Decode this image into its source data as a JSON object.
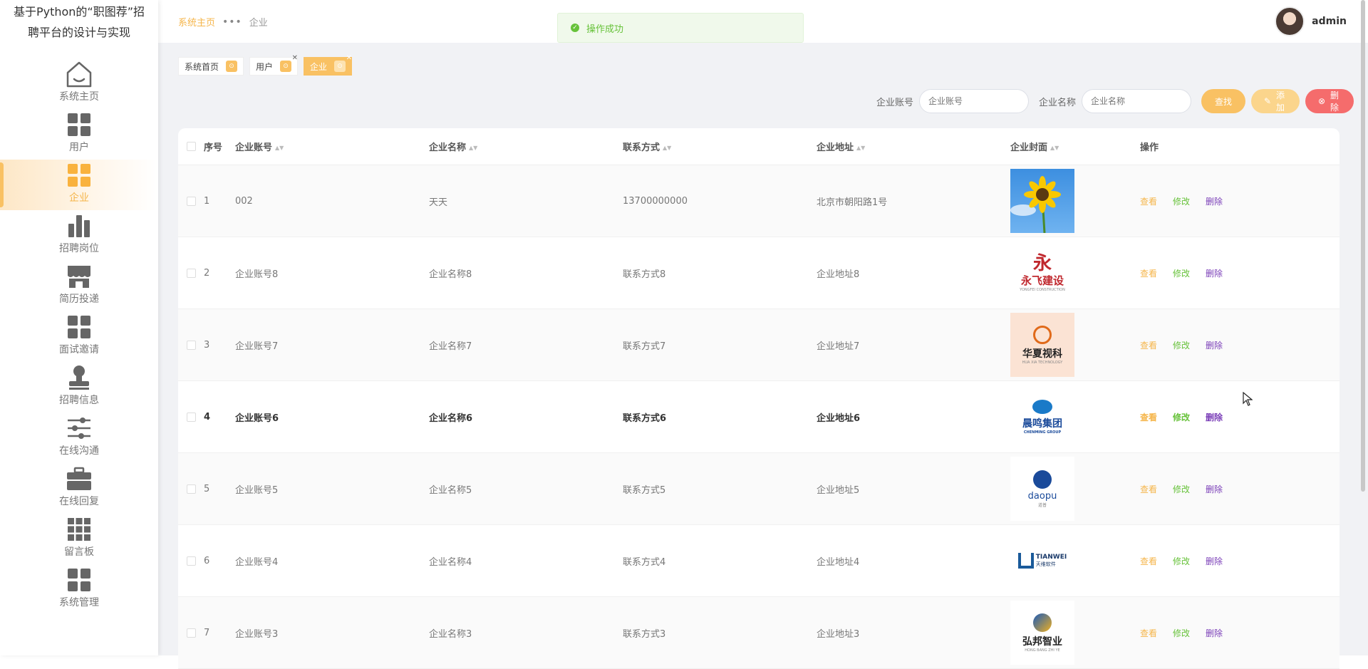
{
  "app": {
    "title": "基于Python的“职图荐”招聘平台的设计与实现"
  },
  "sidebar": {
    "items": [
      {
        "label": "系统主页",
        "icon": "home-icon"
      },
      {
        "label": "用户",
        "icon": "grid-icon"
      },
      {
        "label": "企业",
        "icon": "grid-icon",
        "active": true
      },
      {
        "label": "招聘岗位",
        "icon": "bar-chart-icon"
      },
      {
        "label": "简历投递",
        "icon": "shop-icon"
      },
      {
        "label": "面试邀请",
        "icon": "grid-icon"
      },
      {
        "label": "招聘信息",
        "icon": "stamp-icon"
      },
      {
        "label": "在线沟通",
        "icon": "sliders-icon"
      },
      {
        "label": "在线回复",
        "icon": "toolbox-icon"
      },
      {
        "label": "留言板",
        "icon": "grid-9-icon"
      },
      {
        "label": "系统管理",
        "icon": "grid-icon"
      }
    ]
  },
  "header": {
    "breadcrumb": {
      "home": "系统主页",
      "separator": "•••",
      "current": "企业"
    },
    "toast": "操作成功",
    "user": "admin"
  },
  "tags": [
    {
      "label": "系统首页",
      "closable": false
    },
    {
      "label": "用户",
      "closable": true
    },
    {
      "label": "企业",
      "closable": true,
      "active": true
    }
  ],
  "search": {
    "account_label": "企业账号",
    "account_placeholder": "企业账号",
    "name_label": "企业名称",
    "name_placeholder": "企业名称",
    "search_btn": "查找",
    "add_btn": "添加",
    "delete_btn": "删除"
  },
  "table": {
    "headers": {
      "index": "序号",
      "account": "企业账号",
      "name": "企业名称",
      "phone": "联系方式",
      "address": "企业地址",
      "cover": "企业封面",
      "ops": "操作"
    },
    "ops": {
      "view": "查看",
      "edit": "修改",
      "delete": "删除"
    },
    "rows": [
      {
        "index": "1",
        "account": "002",
        "name": "天天",
        "phone": "13700000000",
        "address": "北京市朝阳路1号",
        "cover": "sunflower"
      },
      {
        "index": "2",
        "account": "企业账号8",
        "name": "企业名称8",
        "phone": "联系方式8",
        "address": "企业地址8",
        "cover": "永飞建设",
        "cover_sub": "YONGFEI CONSTRUCTION"
      },
      {
        "index": "3",
        "account": "企业账号7",
        "name": "企业名称7",
        "phone": "联系方式7",
        "address": "企业地址7",
        "cover": "华夏视科",
        "cover_sub": "HUA XIA TECHNOLOGY"
      },
      {
        "index": "4",
        "account": "企业账号6",
        "name": "企业名称6",
        "phone": "联系方式6",
        "address": "企业地址6",
        "cover": "晨鸣集团",
        "cover_sub": "CHENMING GROUP"
      },
      {
        "index": "5",
        "account": "企业账号5",
        "name": "企业名称5",
        "phone": "联系方式5",
        "address": "企业地址5",
        "cover": "daopu",
        "cover_sub": "道普"
      },
      {
        "index": "6",
        "account": "企业账号4",
        "name": "企业名称4",
        "phone": "联系方式4",
        "address": "企业地址4",
        "cover": "TIANWEI",
        "cover_sub": "天维软件"
      },
      {
        "index": "7",
        "account": "企业账号3",
        "name": "企业名称3",
        "phone": "联系方式3",
        "address": "企业地址3",
        "cover": "弘邦智业",
        "cover_sub": "HONG BANG ZHI YE"
      }
    ]
  },
  "colors": {
    "accent": "#f9c163",
    "success": "#67c23a",
    "danger": "#f56c6c",
    "delete_link": "#7b3fb8"
  }
}
